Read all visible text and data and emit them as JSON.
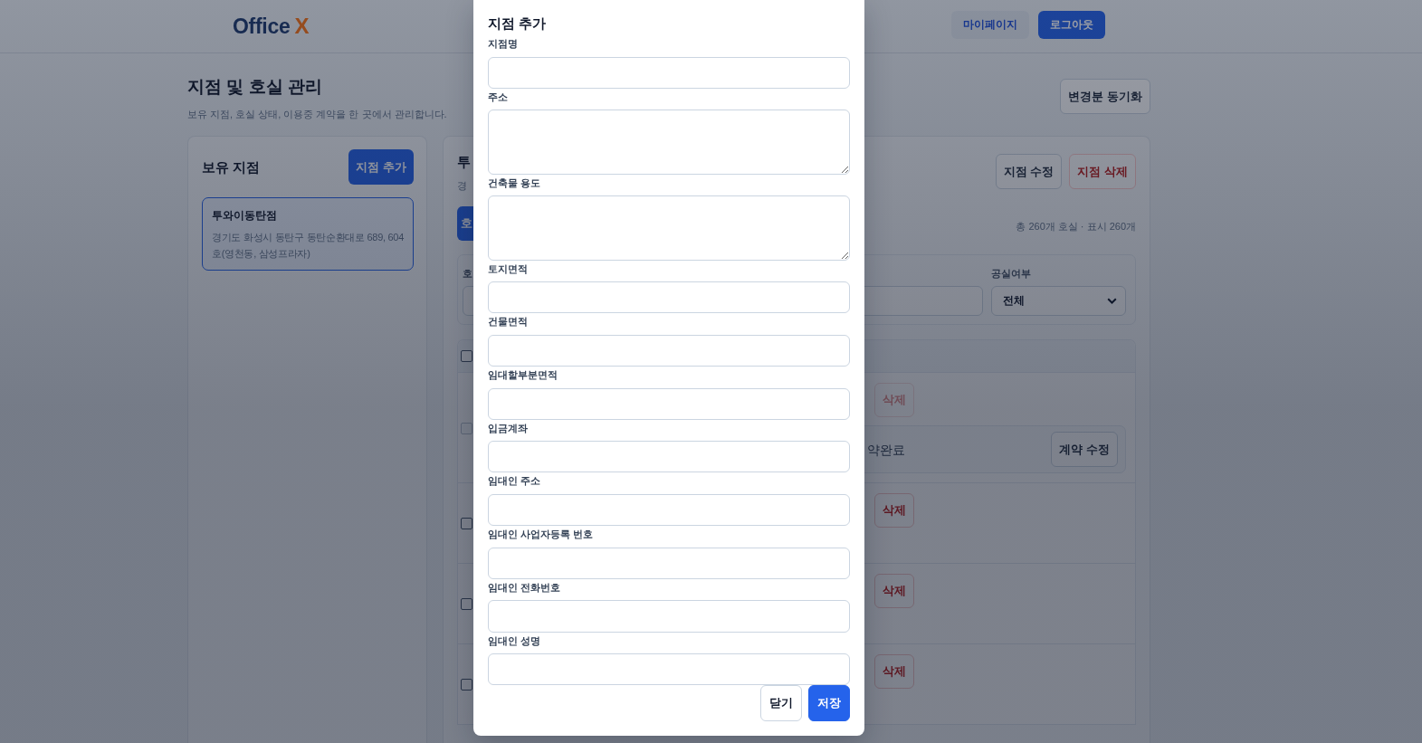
{
  "header": {
    "logo": {
      "text": "Office",
      "accent": "X"
    },
    "buttons": [
      {
        "label": "마이페이지",
        "kind": "secondary"
      },
      {
        "label": "로그아웃",
        "kind": "primary"
      }
    ]
  },
  "page": {
    "title": "지점 및 호실 관리",
    "subtitle": "보유 지점, 호실 상태, 이용중 계약을 한 곳에서 관리합니다.",
    "sync_button": "변경분 동기화"
  },
  "branch_panel": {
    "title": "보유 지점",
    "add_button": "지점 추가",
    "branches": [
      {
        "name": "투와이동탄점",
        "address": "경기도 화성시 동탄구 동탄순환대로 689, 604호(영천동, 삼성프라자)",
        "selected": true
      }
    ]
  },
  "detail_panel": {
    "title": "투",
    "subtitle": "경",
    "buttons": [
      {
        "label": "지점 수정",
        "kind": "default"
      },
      {
        "label": "지점 삭제",
        "kind": "danger"
      }
    ],
    "primary_button": "호",
    "summary": "총 260개 호실 · 표시 260개",
    "filters": [
      {
        "kind": "input",
        "label": "호"
      },
      {
        "kind": "input"
      },
      {
        "kind": "select",
        "label": "공실여부",
        "value": "전체"
      }
    ],
    "list_header": {
      "checked": false
    },
    "rows": [
      {
        "checked": false,
        "disabled": true,
        "delete_button": "삭제",
        "contract": {
          "status": "약완료",
          "edit_button": "계약 수정"
        }
      },
      {
        "checked": false,
        "disabled": false,
        "delete_button": "삭제"
      },
      {
        "checked": false,
        "disabled": false,
        "delete_button": "삭제"
      },
      {
        "checked": false,
        "disabled": false,
        "delete_button": "삭제"
      }
    ]
  },
  "dialog": {
    "title": "지점 추가",
    "fields": [
      {
        "label": "지점명",
        "kind": "input"
      },
      {
        "label": "주소",
        "kind": "textarea"
      },
      {
        "label": "건축물 용도",
        "kind": "textarea"
      },
      {
        "label": "토지면적",
        "kind": "input"
      },
      {
        "label": "건물면적",
        "kind": "input"
      },
      {
        "label": "임대할부분면적",
        "kind": "input"
      },
      {
        "label": "입금계좌",
        "kind": "input"
      },
      {
        "label": "임대인 주소",
        "kind": "input"
      },
      {
        "label": "임대인 사업자등록 번호",
        "kind": "input"
      },
      {
        "label": "임대인 전화번호",
        "kind": "input"
      },
      {
        "label": "임대인 성명",
        "kind": "input"
      }
    ],
    "buttons": [
      {
        "label": "닫기",
        "kind": "secondary"
      },
      {
        "label": "저장",
        "kind": "primary"
      }
    ]
  }
}
